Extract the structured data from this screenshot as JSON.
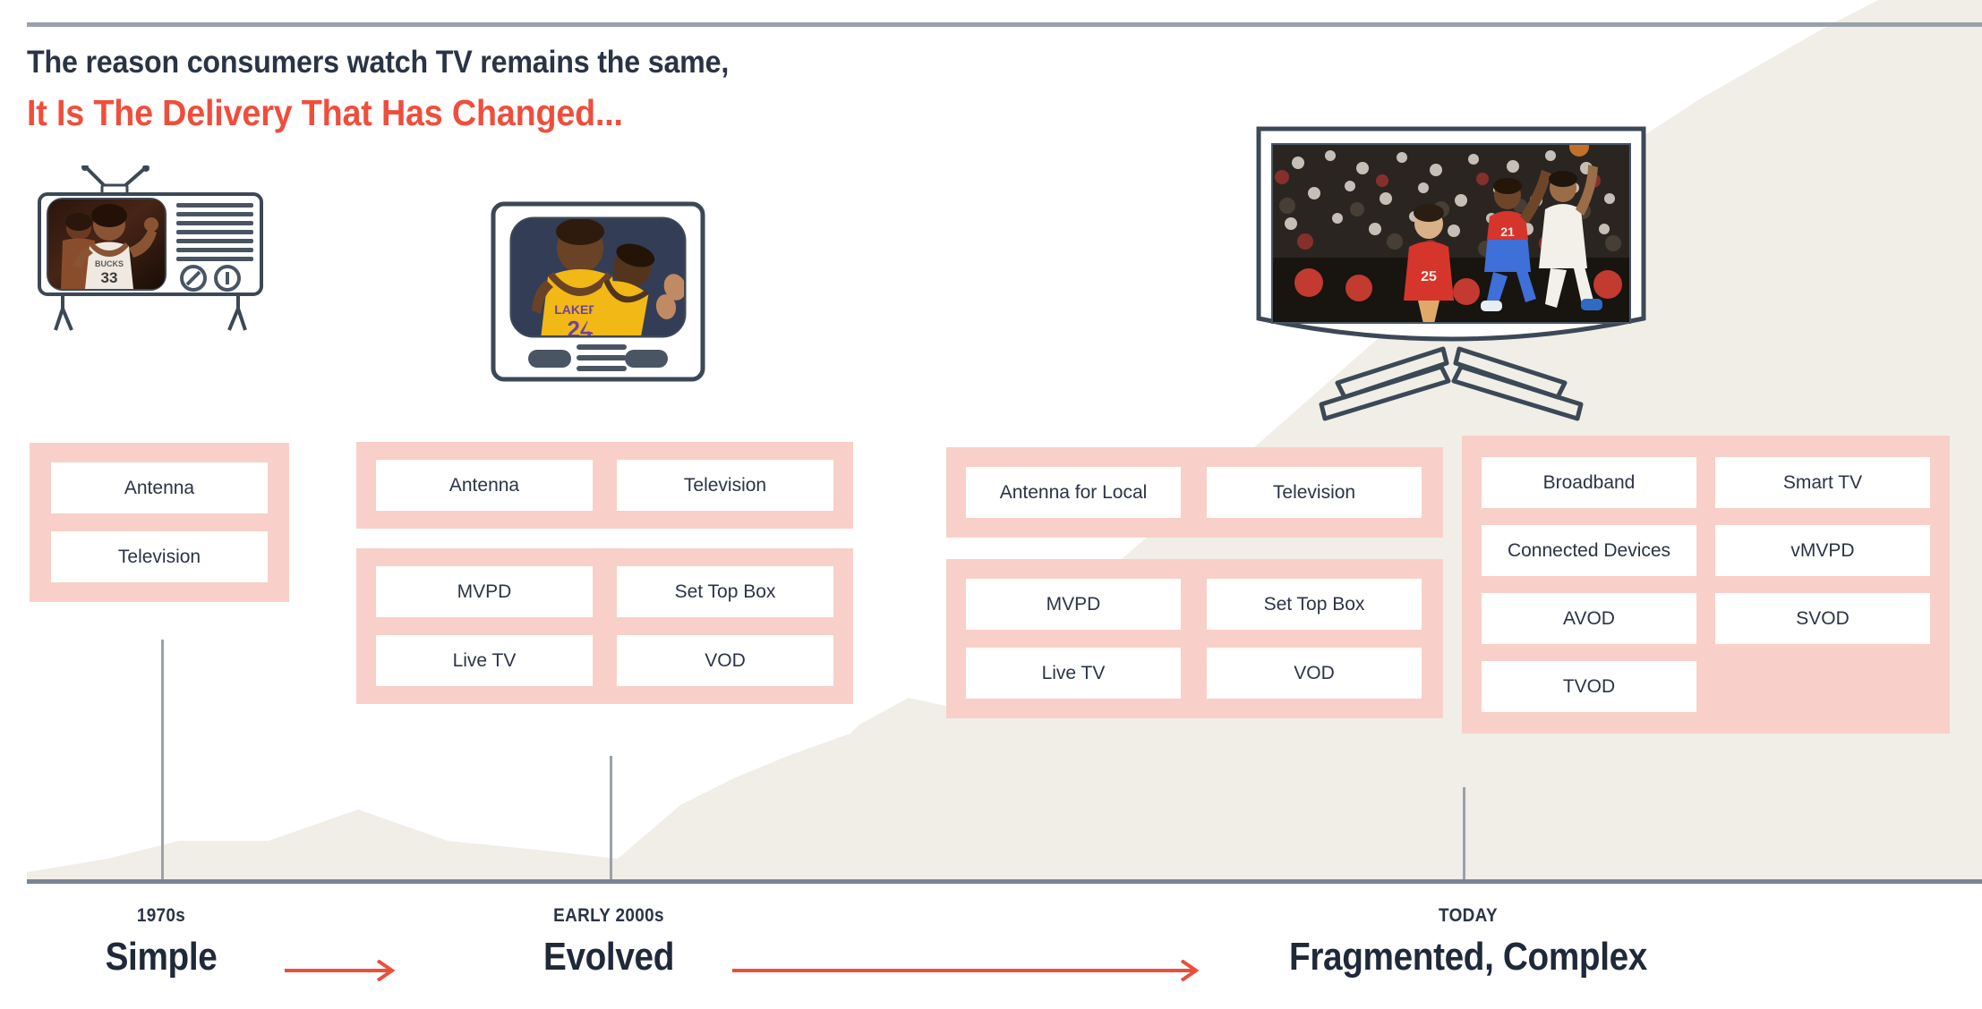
{
  "headline": {
    "line1": "The reason consumers watch TV remains the same,",
    "line2": "It Is The Delivery That Has Changed...",
    "accent_color": "#ef4e3c",
    "dark_color": "#2b3445"
  },
  "colors": {
    "panel_pink": "#f8d0c9",
    "panel_pink_shaded": "#e8c0b5",
    "background_beige": "#f0eee7",
    "chip_white": "#ffffff",
    "rule_gray": "#9aa1ab",
    "axis_gray": "#7b8594",
    "arrow_red": "#e8503a"
  },
  "tvs": [
    {
      "name": "vintage-antenna-tv",
      "screen_caption": "Basketball player, jersey number 33, BUCKS"
    },
    {
      "name": "crt-tv",
      "screen_caption": "Two LAKERS basketball players"
    },
    {
      "name": "flat-screen-tv",
      "screen_caption": "Basketball game, crowd, jerseys 25 and 21"
    }
  ],
  "eras": [
    {
      "id": "era1",
      "period": "1970s",
      "name": "Simple",
      "panels": [
        {
          "rows": [
            [
              "Antenna"
            ],
            [
              "Television"
            ]
          ]
        }
      ]
    },
    {
      "id": "era2",
      "period": "EARLY 2000s",
      "name": "Evolved",
      "panels": [
        {
          "rows": [
            [
              "Antenna",
              "Television"
            ]
          ]
        },
        {
          "rows": [
            [
              "MVPD",
              "Set Top Box"
            ],
            [
              "Live TV",
              "VOD"
            ]
          ]
        }
      ]
    },
    {
      "id": "era3",
      "period": "TODAY",
      "name": "Fragmented, Complex",
      "panels": [
        {
          "rows": [
            [
              "Antenna for Local",
              "Television"
            ]
          ]
        },
        {
          "rows": [
            [
              "MVPD",
              "Set Top Box"
            ],
            [
              "Live TV",
              "VOD"
            ]
          ]
        }
      ]
    },
    {
      "id": "era4",
      "panels": [
        {
          "rows": [
            [
              "Broadband",
              "Smart TV"
            ],
            [
              "Connected Devices",
              "vMVPD"
            ],
            [
              "AVOD",
              "SVOD"
            ],
            [
              "TVOD",
              ""
            ]
          ]
        }
      ]
    }
  ],
  "era_labels": [
    {
      "period": "1970s",
      "name": "Simple"
    },
    {
      "period": "EARLY 2000s",
      "name": "Evolved"
    },
    {
      "period": "TODAY",
      "name": "Fragmented, Complex"
    }
  ],
  "arrows": [
    {
      "name": "progression-arrow-1",
      "length": 112
    },
    {
      "name": "progression-arrow-2",
      "length": 510
    }
  ]
}
